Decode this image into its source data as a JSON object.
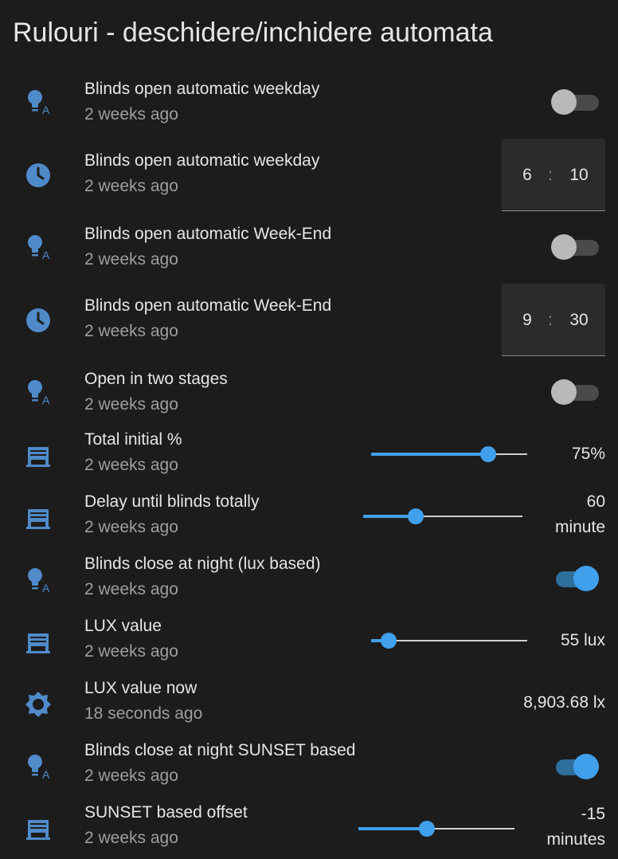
{
  "card": {
    "title": "Rulouri - deschidere/inchidere automata"
  },
  "colors": {
    "background": "#1c1c1c",
    "icon": "#4f8ac9",
    "accent": "#41a0ec"
  },
  "rows": [
    {
      "icon": "robot-bulb-icon",
      "name": "Blinds open automatic weekday",
      "secondary": "2 weeks ago",
      "control": "toggle",
      "on": false
    },
    {
      "icon": "clock-icon",
      "name": "Blinds open automatic weekday",
      "secondary": "2 weeks ago",
      "control": "time",
      "hour": "6",
      "separator": ":",
      "minute": "10"
    },
    {
      "icon": "robot-bulb-icon",
      "name": "Blinds open automatic Week-End",
      "secondary": "2 weeks ago",
      "control": "toggle",
      "on": false
    },
    {
      "icon": "clock-icon",
      "name": "Blinds open automatic Week-End",
      "secondary": "2 weeks ago",
      "control": "time",
      "hour": "9",
      "separator": ":",
      "minute": "30"
    },
    {
      "icon": "robot-bulb-icon",
      "name": "Open in two stages",
      "secondary": "2 weeks ago",
      "control": "toggle",
      "on": false
    },
    {
      "icon": "window-shutter-icon",
      "name": "Total initial %",
      "secondary": "2 weeks ago",
      "control": "slider",
      "fraction": 0.75,
      "value": "75%"
    },
    {
      "icon": "window-shutter-icon",
      "name": "Delay until blinds totally",
      "secondary": "2 weeks ago",
      "control": "slider",
      "fraction": 0.33,
      "value_line1": "60",
      "value_line2": "minute"
    },
    {
      "icon": "robot-bulb-icon",
      "name": "Blinds close at night (lux based)",
      "secondary": "2 weeks ago",
      "control": "toggle",
      "on": true
    },
    {
      "icon": "window-shutter-icon",
      "name": "LUX value",
      "secondary": "2 weeks ago",
      "control": "slider",
      "fraction": 0.11,
      "value": "55 lux"
    },
    {
      "icon": "brightness-icon",
      "name": "LUX value now",
      "secondary": "18 seconds ago",
      "control": "state",
      "value": "8,903.68 lx"
    },
    {
      "icon": "robot-bulb-icon",
      "name": "Blinds close at night SUNSET based",
      "secondary": "2 weeks ago",
      "control": "toggle",
      "on": true
    },
    {
      "icon": "window-shutter-icon",
      "name": "SUNSET based offset",
      "secondary": "2 weeks ago",
      "control": "slider",
      "fraction": 0.44,
      "value_line1": "-15",
      "value_line2": "minutes"
    }
  ]
}
